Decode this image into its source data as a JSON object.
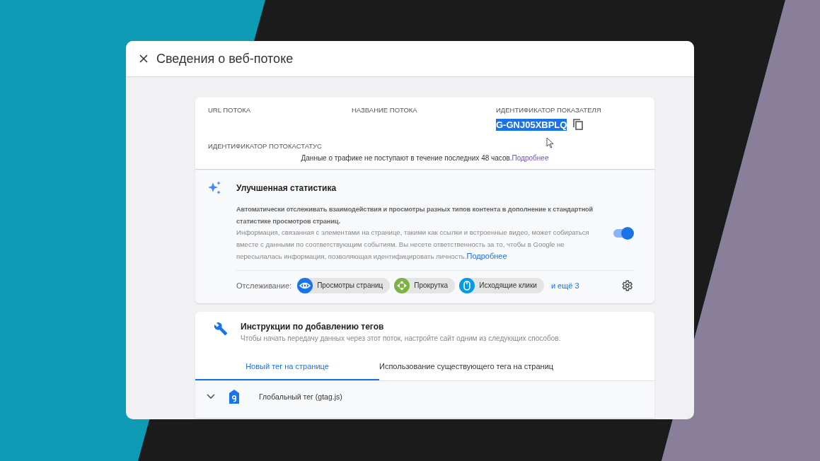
{
  "dialog": {
    "title": "Сведения о веб-потоке"
  },
  "stream": {
    "fields": [
      {
        "label": "URL ПОТОКА"
      },
      {
        "label": "НАЗВАНИЕ ПОТОКА"
      },
      {
        "label": "ИДЕНТИФИКАТОР ПОКАЗАТЕЛЯ",
        "value": "G-GNJ05XBPLQ",
        "selected": true
      }
    ],
    "status_label": "ИДЕНТИФИКАТОР ПОТОКАСТАТУС",
    "notice": "Данные о трафике не поступают в течение последних 48 часов.",
    "notice_link": "Подробнее"
  },
  "enhanced": {
    "title": "Улучшенная статистика",
    "description": "Автоматически отслеживать взаимодействия и просмотры разных типов контента в дополнение к стандартной статистике просмотров страниц.",
    "info": "Информация, связанная с элементами на странице, такими как ссылки и встроенные видео, может собираться вместе с данными по соответствующим событиям. Вы несете ответственность за то, чтобы в Google не пересылалась информация, позволяющая идентифицировать личность.",
    "info_link": "Подробнее",
    "on": true,
    "tracking_label": "Отслеживание:",
    "chips": [
      {
        "label": "Просмотры страниц",
        "kind": "eye",
        "color": "#1a73e8"
      },
      {
        "label": "Прокрутка",
        "kind": "scroll",
        "color": "#7cb342"
      },
      {
        "label": "Исходящие клики",
        "kind": "mouse",
        "color": "#039be5"
      }
    ],
    "more": "и ещё 3"
  },
  "tagging": {
    "title": "Инструкции по добавлению тегов",
    "subtitle": "Чтобы начать передачу данных через этот поток, настройте сайт одним из следующих способов.",
    "tabs": [
      {
        "label": "Новый тег на странице",
        "selected": true
      },
      {
        "label": "Использование существующего тега на страниц",
        "selected": false
      }
    ],
    "rows": [
      {
        "label": "Глобальный тег (gtag.js)",
        "expanded": false
      }
    ]
  }
}
